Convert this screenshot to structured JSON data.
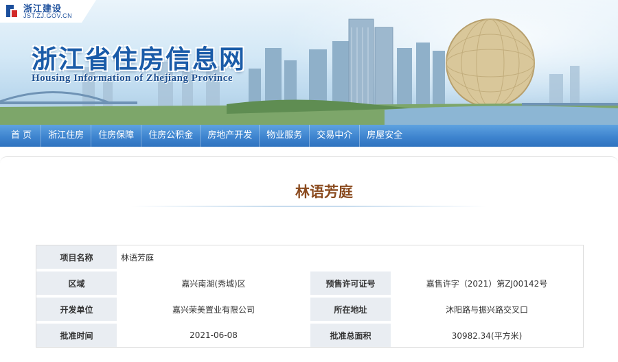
{
  "header": {
    "logo_cn": "浙江建设",
    "logo_url": "JST.ZJ.GOV.CN",
    "site_title": "浙江省住房信息网",
    "site_subtitle": "Housing Information of Zhejiang Province"
  },
  "nav": {
    "items": [
      "首 页",
      "浙江住房",
      "住房保障",
      "住房公积金",
      "房地产开发",
      "物业服务",
      "交易中介",
      "房屋安全"
    ]
  },
  "project": {
    "title": "林语芳庭",
    "rows": [
      {
        "label": "项目名称",
        "value": "林语芳庭"
      },
      {
        "label": "区域",
        "value": "嘉兴南湖(秀城)区",
        "label2": "预售许可证号",
        "value2": "嘉售许字（2021）第ZJ00142号"
      },
      {
        "label": "开发单位",
        "value": "嘉兴荣美置业有限公司",
        "label2": "所在地址",
        "value2": "沐阳路与振兴路交叉口"
      },
      {
        "label": "批准时间",
        "value": "2021-06-08",
        "label2": "批准总面积",
        "value2": "30982.34(平方米)"
      }
    ]
  },
  "colors": {
    "nav_bg": "#3e84cf",
    "title_brown": "#8a4a1e",
    "label_bg": "#e9edf2",
    "brand_blue": "#1a5ba8"
  }
}
